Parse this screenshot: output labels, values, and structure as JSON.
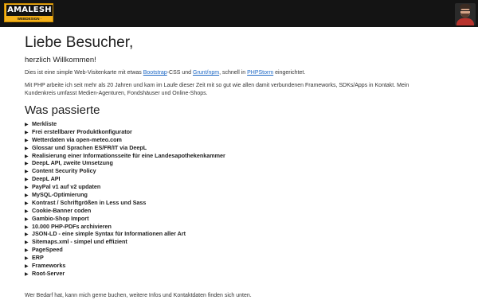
{
  "header": {
    "logo_text": "AMALESH",
    "logo_subtext": "WEBDESIGN · PROGRAMMIERUNG",
    "avatar_label": "Profilbild"
  },
  "main": {
    "title": "Liebe Besucher,",
    "subtitle": "herzlich Willkommen!",
    "intro": {
      "part1": "Dies ist eine simple Web-Visitenkarte mit etwas ",
      "link1": "Bootstrap",
      "part2": "-CSS und ",
      "link2": "Grunt/npm",
      "part3": ", schnell in ",
      "link3": "PHPStorm",
      "part4": " eingerichtet."
    },
    "php_text": "Mit PHP arbeite ich seit mehr als 20 Jahren und kam im Laufe dieser Zeit mit so gut wie allen damit verbundenen Frameworks, SDKs/Apps in Kontakt. Mein Kundenkreis umfasst Medien-Agenturen, Fondshäuser und Online-Shops.",
    "section_title": "Was passierte",
    "triangle_icon": "▶",
    "items": [
      "Merkliste",
      "Frei erstellbarer Produktkonfigurator",
      "Wetterdaten via open-meteo.com",
      "Glossar und Sprachen ES/FR/IT via DeepL",
      "Realisierung einer Informationsseite für eine Landesapothekenkammer",
      "DeepL API, zweite Umsetzung",
      "Content Security Policy",
      "DeepL API",
      "PayPal v1 auf v2 updaten",
      "MySQL-Optimierung",
      "Kontrast / Schriftgrößen in Less und Sass",
      "Cookie-Banner coden",
      "Gambio-Shop Import",
      "10.000 PHP-PDFs archivieren",
      "JSON-LD - eine simple Syntax für Informationen aller Art",
      "Sitemaps.xml - simpel und effizient",
      "PageSpeed",
      "ERP",
      "Frameworks",
      "Root-Server"
    ],
    "footer_text": "Wer Bedarf hat, kann mich gerne buchen, weitere Infos und Kontaktdaten finden sich unten."
  },
  "colors": {
    "topbar": "#141414",
    "logo_yellow": "#f3b11c",
    "link": "#1a66c4"
  }
}
